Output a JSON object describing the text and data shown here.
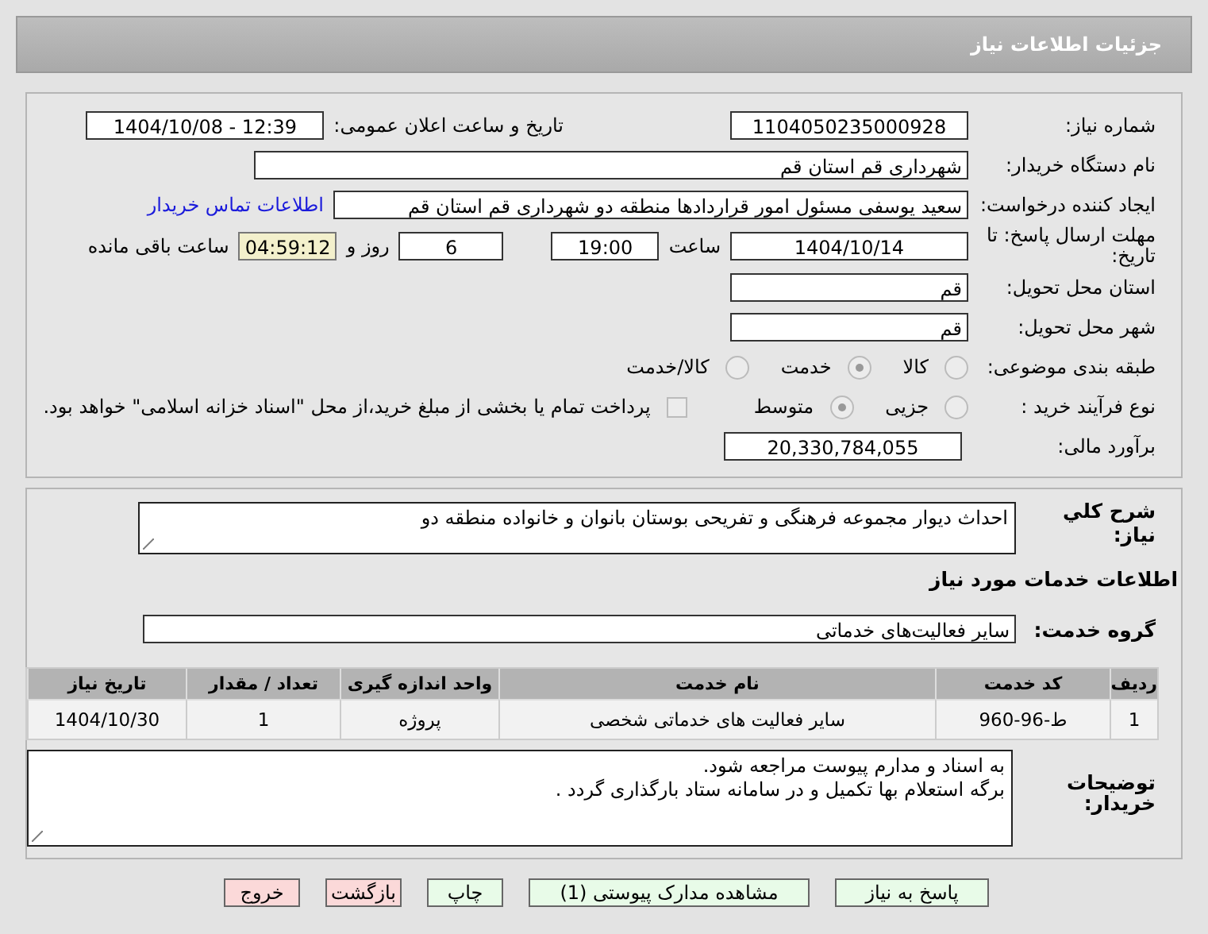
{
  "header": {
    "title": "جزئیات اطلاعات نیاز"
  },
  "need_number": {
    "label": "شماره نیاز:",
    "value": "1104050235000928"
  },
  "announce": {
    "label": "تاریخ و ساعت اعلان عمومی:",
    "value": "1404/10/08 - 12:39"
  },
  "buyer": {
    "label": "نام دستگاه خریدار:",
    "value": "شهرداری قم استان قم"
  },
  "requester": {
    "label": "ایجاد کننده درخواست:",
    "value": "سعید یوسفی مسئول امور قراردادها منطقه دو شهرداری قم استان قم",
    "link": "اطلاعات تماس خریدار"
  },
  "deadline": {
    "label": "مهلت ارسال پاسخ: تا تاریخ:",
    "date": "1404/10/14",
    "time_label": "ساعت",
    "time": "19:00",
    "days": "6",
    "days_label": "روز و",
    "remaining": "04:59:12",
    "remaining_label": "ساعت باقی مانده"
  },
  "province": {
    "label": "استان محل تحویل:",
    "value": "قم"
  },
  "city": {
    "label": "شهر محل تحویل:",
    "value": "قم"
  },
  "category": {
    "label": "طبقه بندی موضوعی:",
    "options": [
      {
        "label": "کالا",
        "selected": false
      },
      {
        "label": "خدمت",
        "selected": true
      },
      {
        "label": "کالا/خدمت",
        "selected": false
      }
    ]
  },
  "purchase_type": {
    "label": "نوع فرآیند خرید :",
    "options": [
      {
        "label": "جزیی",
        "selected": false
      },
      {
        "label": "متوسط",
        "selected": true
      }
    ],
    "payment": {
      "checked": false,
      "text": "پرداخت تمام یا بخشی از مبلغ خرید،از محل \"اسناد خزانه اسلامی\" خواهد بود."
    }
  },
  "budget": {
    "label": "برآورد مالی:",
    "value": "20,330,784,055"
  },
  "description": {
    "label": "شرح كلي نياز:",
    "value": "احداث دیوار مجموعه فرهنگی و تفریحی بوستان بانوان و خانواده منطقه دو"
  },
  "services_heading": "اطلاعات خدمات مورد نیاز",
  "service_group": {
    "label": "گروه خدمت:",
    "value": "سایر فعالیت‌های خدماتی"
  },
  "table": {
    "columns": [
      "ردیف",
      "کد خدمت",
      "نام خدمت",
      "واحد اندازه گیری",
      "تعداد / مقدار",
      "تاریخ نیاز"
    ],
    "rows": [
      [
        "1",
        "ط-96-960",
        "سایر فعالیت های خدماتی شخصی",
        "پروژه",
        "1",
        "1404/10/30"
      ]
    ]
  },
  "notes": {
    "label": "توضیحات خریدار:",
    "lines": [
      "به اسناد و مدارم پیوست مراجعه شود.",
      "برگه استعلام بها تکمیل و در سامانه ستاد بارگذاری گردد ."
    ]
  },
  "buttons": [
    {
      "label": "پاسخ به نیاز",
      "kind": "normal"
    },
    {
      "label": "مشاهده مدارک پیوستی (1)",
      "kind": "normal"
    },
    {
      "label": "چاپ",
      "kind": "normal"
    },
    {
      "label": "بازگشت",
      "kind": "danger"
    },
    {
      "label": "خروج",
      "kind": "danger"
    }
  ]
}
